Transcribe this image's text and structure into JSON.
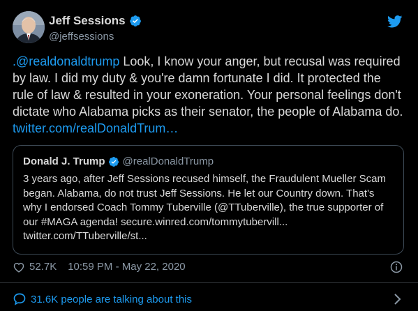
{
  "author": {
    "name": "Jeff Sessions",
    "handle": "@jeffsessions"
  },
  "tweet": {
    "mention": ".@realdonaldtrump",
    "body": " Look, I know your anger, but recusal was required by law. I did my duty & you're damn fortunate I did. It protected the rule of law & resulted in your exoneration. Your personal feelings don't dictate who Alabama picks as their senator, the people of Alabama do. ",
    "link": "twitter.com/realDonaldTrum…"
  },
  "quoted": {
    "name": "Donald J. Trump",
    "handle": "@realDonaldTrump",
    "text": "3 years ago, after Jeff Sessions recused himself, the Fraudulent Mueller Scam began. Alabama, do not trust Jeff Sessions. He let our Country down. That's why I endorsed Coach Tommy Tuberville (@TTuberville), the true supporter of our #MAGA agenda! secure.winred.com/tommytubervill... twitter.com/TTuberville/st..."
  },
  "meta": {
    "likes": "52.7K",
    "timestamp": "10:59 PM - May 22, 2020"
  },
  "footer": {
    "talking": "31.6K people are talking about this"
  },
  "colors": {
    "background": "#000000",
    "accent": "#1d9bf0",
    "secondary_text": "#8b98a5",
    "border": "#3d4a56"
  },
  "icons": {
    "brand": "twitter-bird-icon",
    "verified": "verified-badge-icon",
    "like": "heart-icon",
    "info": "info-icon",
    "comments": "speech-bubble-icon",
    "chevron": "chevron-right-icon"
  }
}
